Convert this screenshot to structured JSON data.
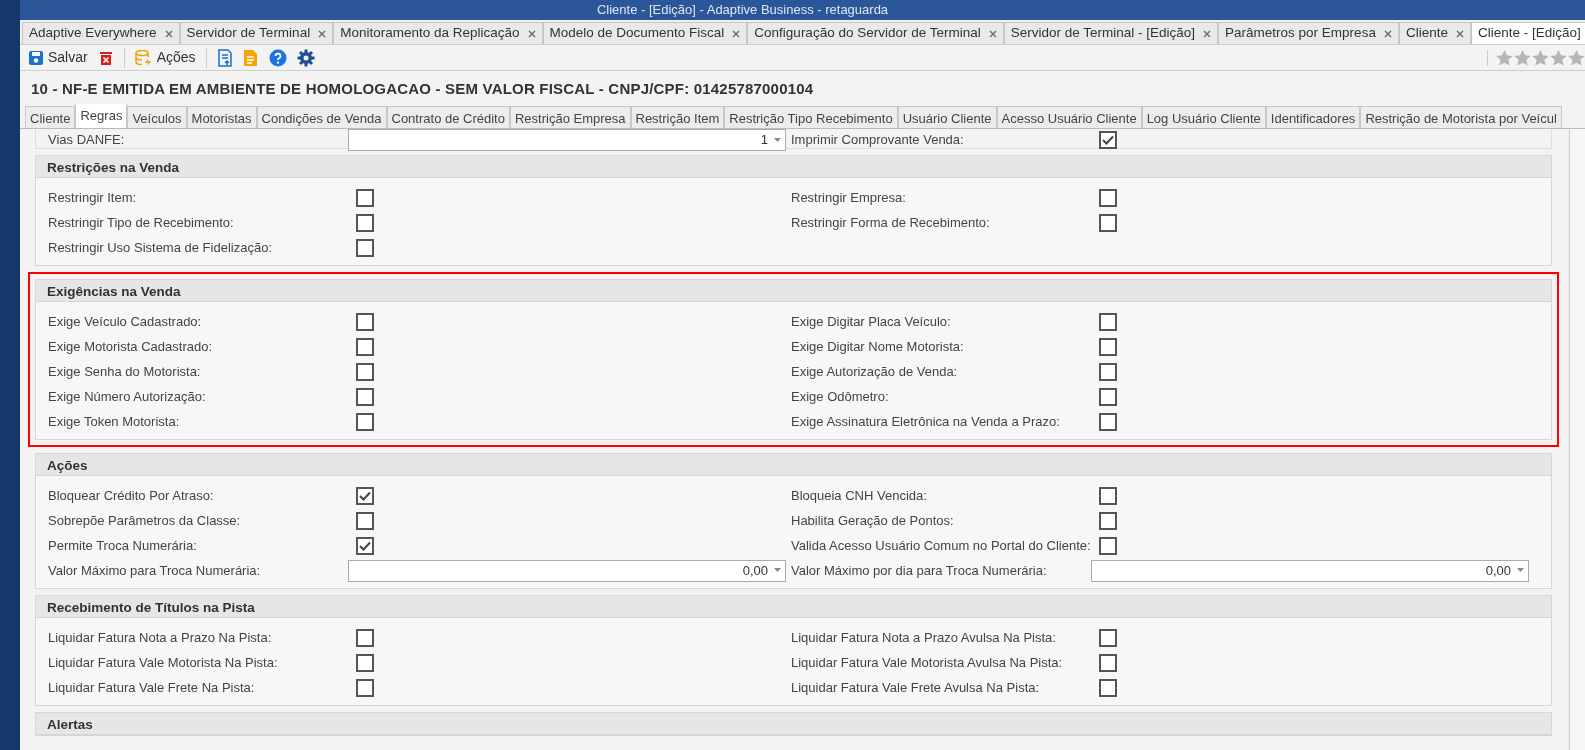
{
  "window": {
    "title": "Cliente - [Edição] - Adaptive Business - retaguarda"
  },
  "doc_tabs": [
    {
      "label": "Adaptive Everywhere",
      "selected": false
    },
    {
      "label": "Servidor de Terminal",
      "selected": false
    },
    {
      "label": "Monitoramento da Replicação",
      "selected": false
    },
    {
      "label": "Modelo de Documento Fiscal",
      "selected": false
    },
    {
      "label": "Configuração do Servidor de Terminal",
      "selected": false
    },
    {
      "label": "Servidor de Terminal - [Edição]",
      "selected": false
    },
    {
      "label": "Parâmetros por Empresa",
      "selected": false
    },
    {
      "label": "Cliente",
      "selected": false
    },
    {
      "label": "Cliente - [Edição]",
      "selected": true
    }
  ],
  "toolbar": [
    {
      "kind": "save",
      "label": "Salvar"
    },
    {
      "kind": "delete"
    },
    {
      "kind": "actions",
      "label": "Ações"
    },
    {
      "kind": "export"
    },
    {
      "kind": "report"
    },
    {
      "kind": "help"
    },
    {
      "kind": "settings"
    }
  ],
  "rating": {
    "stars": 0
  },
  "heading": "10 - NF-E EMITIDA EM AMBIENTE DE HOMOLOGACAO - SEM VALOR FISCAL - CNPJ/CPF: 01425787000104",
  "record_tabs": [
    {
      "label": "Cliente",
      "selected": false
    },
    {
      "label": "Regras",
      "selected": true
    },
    {
      "label": "Veículos",
      "selected": false
    },
    {
      "label": "Motoristas",
      "selected": false
    },
    {
      "label": "Condições de Venda",
      "selected": false
    },
    {
      "label": "Contrato de Crédito",
      "selected": false
    },
    {
      "label": "Restrição Empresa",
      "selected": false
    },
    {
      "label": "Restrição Item",
      "selected": false
    },
    {
      "label": "Restrição Tipo Recebimento",
      "selected": false
    },
    {
      "label": "Usuário Cliente",
      "selected": false
    },
    {
      "label": "Acesso Usuário Cliente",
      "selected": false
    },
    {
      "label": "Log Usuário Cliente",
      "selected": false
    },
    {
      "label": "Identificadores",
      "selected": false
    },
    {
      "label": "Restrição de Motorista por Veícul",
      "selected": false
    }
  ],
  "top_row": [
    {
      "kind": "number",
      "label": "Vias DANFE:",
      "value": "1"
    },
    {
      "kind": "checkbox",
      "label": "Imprimir Comprovante Venda:",
      "checked": true
    }
  ],
  "sections": [
    {
      "title": "Restrições na Venda",
      "highlighted": false,
      "rows": [
        [
          {
            "kind": "checkbox",
            "label": "Restringir Item:",
            "checked": false
          },
          {
            "kind": "checkbox",
            "label": "Restringir Empresa:",
            "checked": false
          }
        ],
        [
          {
            "kind": "checkbox",
            "label": "Restringir Tipo de Recebimento:",
            "checked": false
          },
          {
            "kind": "checkbox",
            "label": "Restringir Forma de Recebimento:",
            "checked": false
          }
        ],
        [
          {
            "kind": "checkbox",
            "label": "Restringir Uso Sistema de Fidelização:",
            "checked": false
          }
        ]
      ]
    },
    {
      "title": "Exigências na Venda",
      "highlighted": true,
      "rows": [
        [
          {
            "kind": "checkbox",
            "label": "Exige Veículo Cadastrado:",
            "checked": false
          },
          {
            "kind": "checkbox",
            "label": "Exige Digitar Placa Veículo:",
            "checked": false
          }
        ],
        [
          {
            "kind": "checkbox",
            "label": "Exige Motorista Cadastrado:",
            "checked": false
          },
          {
            "kind": "checkbox",
            "label": "Exige Digitar Nome Motorista:",
            "checked": false
          }
        ],
        [
          {
            "kind": "checkbox",
            "label": "Exige Senha do Motorista:",
            "checked": false
          },
          {
            "kind": "checkbox",
            "label": "Exige Autorização de Venda:",
            "checked": false
          }
        ],
        [
          {
            "kind": "checkbox",
            "label": "Exige Número Autorização:",
            "checked": false
          },
          {
            "kind": "checkbox",
            "label": "Exige Odômetro:",
            "checked": false
          }
        ],
        [
          {
            "kind": "checkbox",
            "label": "Exige Token Motorista:",
            "checked": false
          },
          {
            "kind": "checkbox",
            "label": "Exige Assinatura Eletrônica na Venda a Prazo:",
            "checked": false
          }
        ]
      ]
    },
    {
      "title": "Ações",
      "highlighted": false,
      "rows": [
        [
          {
            "kind": "checkbox",
            "label": "Bloquear Crédito Por Atraso:",
            "checked": true
          },
          {
            "kind": "checkbox",
            "label": "Bloqueia CNH Vencida:",
            "checked": false
          }
        ],
        [
          {
            "kind": "checkbox",
            "label": "Sobrepõe Parâmetros da Classe:",
            "checked": false
          },
          {
            "kind": "checkbox",
            "label": "Habilita Geração de Pontos:",
            "checked": false
          }
        ],
        [
          {
            "kind": "checkbox",
            "label": "Permite Troca Numerária:",
            "checked": true
          },
          {
            "kind": "checkbox",
            "label": "Valida Acesso Usuário Comum no Portal do Cliente:",
            "checked": false
          }
        ],
        [
          {
            "kind": "number",
            "label": "Valor Máximo para Troca Numerária:",
            "value": "0,00"
          },
          {
            "kind": "number",
            "label": "Valor Máximo por dia para Troca Numerária:",
            "value": "0,00"
          }
        ]
      ]
    },
    {
      "title": "Recebimento de Títulos na Pista",
      "highlighted": false,
      "rows": [
        [
          {
            "kind": "checkbox",
            "label": "Liquidar Fatura Nota a Prazo Na Pista:",
            "checked": false
          },
          {
            "kind": "checkbox",
            "label": "Liquidar Fatura Nota a Prazo Avulsa Na Pista:",
            "checked": false
          }
        ],
        [
          {
            "kind": "checkbox",
            "label": "Liquidar Fatura Vale Motorista Na Pista:",
            "checked": false
          },
          {
            "kind": "checkbox",
            "label": "Liquidar Fatura Vale Motorista Avulsa Na Pista:",
            "checked": false
          }
        ],
        [
          {
            "kind": "checkbox",
            "label": "Liquidar Fatura Vale Frete Na Pista:",
            "checked": false
          },
          {
            "kind": "checkbox",
            "label": "Liquidar Fatura Vale Frete Avulsa Na Pista:",
            "checked": false
          }
        ]
      ]
    },
    {
      "title": "Alertas",
      "highlighted": false
    }
  ]
}
